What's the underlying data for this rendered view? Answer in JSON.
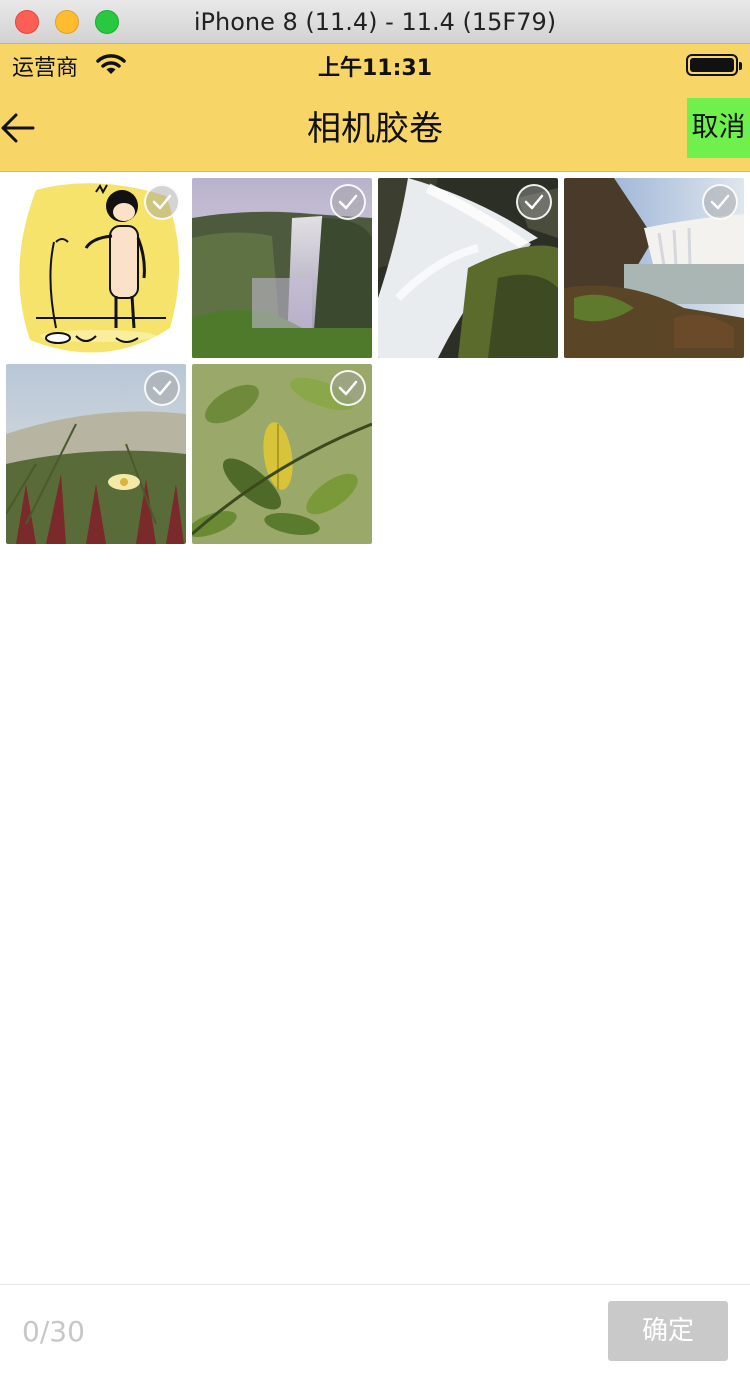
{
  "window": {
    "title": "iPhone 8 (11.4) - 11.4 (15F79)"
  },
  "status_bar": {
    "carrier": "运营商",
    "time": "上午11:31"
  },
  "nav": {
    "title": "相机胶卷",
    "cancel_label": "取消"
  },
  "photos": [
    {
      "name": "cartoon-figure",
      "selected": false
    },
    {
      "name": "waterfall-cliff",
      "selected": false
    },
    {
      "name": "waterfall-rocks",
      "selected": false
    },
    {
      "name": "waterfall-river",
      "selected": false
    },
    {
      "name": "flower-grass",
      "selected": false
    },
    {
      "name": "green-leaves",
      "selected": false
    }
  ],
  "footer": {
    "count": "0/30",
    "confirm_label": "确定"
  },
  "colors": {
    "nav_bg": "#f7d566",
    "cancel_bg": "#6ff04c",
    "confirm_bg": "#c9c9c9"
  }
}
